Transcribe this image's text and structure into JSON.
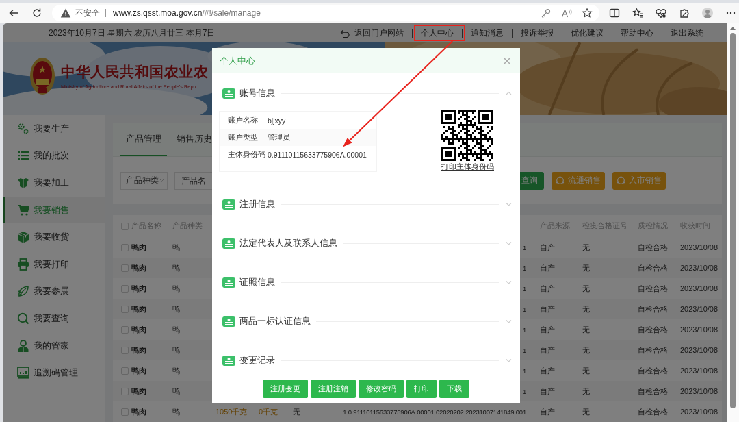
{
  "browser": {
    "security_label": "不安全",
    "url": "www.zs.qsst.moa.gov.cn/#!/sale/manage"
  },
  "top_bar": {
    "date": "2023年10月7日 星期六 农历八月廿三 本月7日",
    "links": [
      {
        "label": "返回门户网站",
        "annotated": false
      },
      {
        "label": "个人中心",
        "annotated": true
      },
      {
        "label": "通知消息",
        "annotated": false
      },
      {
        "label": "投诉举报",
        "annotated": false
      },
      {
        "label": "优化建议",
        "annotated": false
      },
      {
        "label": "帮助中心",
        "annotated": false
      },
      {
        "label": "退出系统",
        "annotated": false
      }
    ]
  },
  "banner": {
    "title": "中华人民共和国农业农",
    "subtitle": "Ministry of Agriculture and Rural Affairs of the People's Repu"
  },
  "sidebar": {
    "items": [
      {
        "label": "我要生产",
        "selected": false
      },
      {
        "label": "我的批次",
        "selected": false
      },
      {
        "label": "我要加工",
        "selected": false
      },
      {
        "label": "我要销售",
        "selected": true
      },
      {
        "label": "我要收货",
        "selected": false
      },
      {
        "label": "我要打印",
        "selected": false
      },
      {
        "label": "我要参展",
        "selected": false
      },
      {
        "label": "我要查询",
        "selected": false
      },
      {
        "label": "我的管家",
        "selected": false
      },
      {
        "label": "追溯码管理",
        "selected": false
      }
    ]
  },
  "tabs": [
    {
      "label": "产品管理",
      "selected": true
    },
    {
      "label": "销售历史",
      "selected": false
    }
  ],
  "filters": [
    {
      "kind": "select",
      "placeholder": "产品种类"
    },
    {
      "kind": "input",
      "placeholder": "产品名"
    }
  ],
  "actions": [
    {
      "kind": "primary",
      "label": "查询"
    },
    {
      "kind": "warning",
      "label": "流通销售"
    },
    {
      "kind": "warning",
      "label": "入市销售"
    }
  ],
  "table": {
    "all_checked": false,
    "columns": [
      "产品名称",
      "产品种类",
      "产品来源",
      "检疫合格证号",
      "质检情况",
      "收获时间"
    ],
    "rows": [
      {
        "checked": false,
        "product_name": "鸭肉",
        "product_type": "鸭",
        "column_6": "1",
        "product_source": "自产",
        "certificate_no": "无",
        "quality_check": "自检合格",
        "harvest_time": "2023/10/08"
      },
      {
        "checked": false,
        "product_name": "鸭肉",
        "product_type": "鸭",
        "column_6": "1",
        "product_source": "自产",
        "certificate_no": "无",
        "quality_check": "自检合格",
        "harvest_time": "2023/10/08"
      },
      {
        "checked": false,
        "product_name": "鸭肉",
        "product_type": "鸭",
        "column_6": "1",
        "product_source": "自产",
        "certificate_no": "无",
        "quality_check": "自检合格",
        "harvest_time": "2023/10/08"
      },
      {
        "checked": false,
        "product_name": "鸭肉",
        "product_type": "鸭",
        "column_6": "1",
        "product_source": "自产",
        "certificate_no": "无",
        "quality_check": "自检合格",
        "harvest_time": "2023/10/08"
      },
      {
        "checked": false,
        "product_name": "鸭肉",
        "product_type": "鸭",
        "column_6": "1",
        "product_source": "自产",
        "certificate_no": "无",
        "quality_check": "自检合格",
        "harvest_time": "2023/10/08"
      },
      {
        "checked": false,
        "product_name": "鸭肉",
        "product_type": "鸭",
        "column_6": "1",
        "product_source": "自产",
        "certificate_no": "无",
        "quality_check": "自检合格",
        "harvest_time": "2023/10/08"
      },
      {
        "checked": false,
        "product_name": "鸭肉",
        "product_type": "鸭",
        "column_6": "1",
        "product_source": "自产",
        "certificate_no": "无",
        "quality_check": "自检合格",
        "harvest_time": "2023/10/08"
      },
      {
        "checked": false,
        "product_name": "鸭肉",
        "product_type": "鸭",
        "column_6": "1",
        "product_source": "自产",
        "certificate_no": "无",
        "quality_check": "自检合格",
        "harvest_time": "2023/10/08"
      },
      {
        "checked": false,
        "product_name": "鸭肉",
        "product_type": "鸭",
        "column_3": "1050千克",
        "column_4": "0千克",
        "column_5": "无",
        "column_6": "1.0.91110115633775906A.00001.02020202.20231007141849.001",
        "product_source": "自产",
        "certificate_no": "无",
        "quality_check": "自检合格",
        "harvest_time": "2023/10/08"
      }
    ]
  },
  "dialog": {
    "title": "个人中心",
    "sections": [
      {
        "title": "账号信息",
        "expanded": true,
        "fields": [
          {
            "label": "账户名称",
            "value": "bjjxyy"
          },
          {
            "label": "账户类型",
            "value": "管理员"
          },
          {
            "label": "主体身份码",
            "value": "0.91110115633775906A.00001"
          }
        ],
        "qr_link": "打印主体身份码"
      },
      {
        "title": "注册信息",
        "expanded": false
      },
      {
        "title": "法定代表人及联系人信息",
        "expanded": false
      },
      {
        "title": "证照信息",
        "expanded": false
      },
      {
        "title": "两品一标认证信息",
        "expanded": false
      },
      {
        "title": "变更记录",
        "expanded": false
      }
    ],
    "buttons": [
      "注册变更",
      "注册注销",
      "修改密码",
      "打印",
      "下载"
    ]
  }
}
